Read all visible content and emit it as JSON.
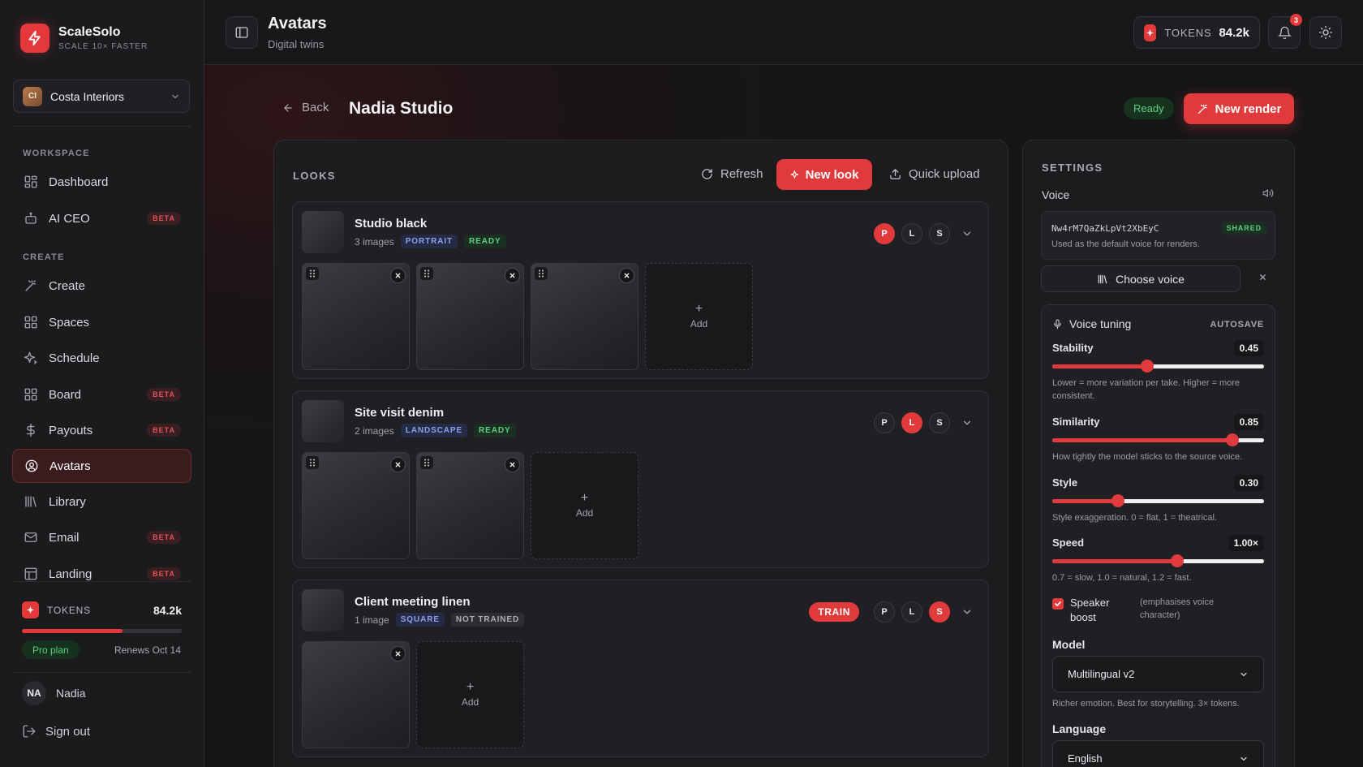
{
  "brand": {
    "name": "ScaleSolo",
    "tagline": "SCALE 10× FASTER"
  },
  "workspace": {
    "initials": "CI",
    "name": "Costa Interiors"
  },
  "sidebar": {
    "sections": [
      {
        "label": "WORKSPACE",
        "items": [
          {
            "label": "Dashboard",
            "icon": "dashboard-icon",
            "badge": ""
          },
          {
            "label": "AI CEO",
            "icon": "robot-icon",
            "badge": "BETA"
          }
        ]
      },
      {
        "label": "CREATE",
        "items": [
          {
            "label": "Create",
            "icon": "magic-wand-icon",
            "badge": ""
          },
          {
            "label": "Spaces",
            "icon": "grid-icon",
            "badge": ""
          },
          {
            "label": "Schedule",
            "icon": "sparkle-icon",
            "badge": ""
          },
          {
            "label": "Board",
            "icon": "board-icon",
            "badge": "BETA"
          },
          {
            "label": "Payouts",
            "icon": "dollar-icon",
            "badge": "BETA"
          },
          {
            "label": "Avatars",
            "icon": "user-circle-icon",
            "badge": "",
            "active": true
          },
          {
            "label": "Library",
            "icon": "library-icon",
            "badge": ""
          },
          {
            "label": "Email",
            "icon": "mail-icon",
            "badge": "BETA"
          },
          {
            "label": "Landing",
            "icon": "layout-icon",
            "badge": "BETA"
          }
        ]
      }
    ],
    "tokens": {
      "label": "TOKENS",
      "value": "84.2k",
      "usage_fraction": 0.63
    },
    "plan": "Pro plan",
    "renews": "Renews Oct 14",
    "user": {
      "initials": "NA",
      "name": "Nadia"
    },
    "sign_out": "Sign out"
  },
  "header": {
    "title": "Avatars",
    "subtitle": "Digital twins",
    "tokens_label": "TOKENS",
    "tokens_value": "84.2k",
    "notifications_count": "3"
  },
  "page": {
    "back_label": "Back",
    "title": "Nadia Studio",
    "status": "Ready",
    "new_render": "New render"
  },
  "looks": {
    "label": "LOOKS",
    "refresh": "Refresh",
    "new_look": "New look",
    "quick_upload": "Quick upload",
    "add_label": "Add",
    "items": [
      {
        "name": "Studio black",
        "count": "3 images",
        "tags": [
          "PORTRAIT",
          "READY"
        ],
        "formats": [
          "P",
          "L",
          "S"
        ],
        "active_format": "P",
        "train": "",
        "images": 3
      },
      {
        "name": "Site visit denim",
        "count": "2 images",
        "tags": [
          "LANDSCAPE",
          "READY"
        ],
        "formats": [
          "P",
          "L",
          "S"
        ],
        "active_format": "L",
        "train": "",
        "images": 2
      },
      {
        "name": "Client meeting linen",
        "count": "1 image",
        "tags": [
          "SQUARE",
          "NOT TRAINED"
        ],
        "formats": [
          "P",
          "L",
          "S"
        ],
        "active_format": "S",
        "train": "TRAIN",
        "images": 1
      }
    ]
  },
  "settings": {
    "label": "SETTINGS",
    "voice_label": "Voice",
    "voice_id": "Nw4rM7QaZkLpVt2XbEyC",
    "voice_badge": "SHARED",
    "voice_desc": "Used as the default voice for renders.",
    "choose_voice": "Choose voice",
    "tuning_title": "Voice tuning",
    "autosave": "AUTOSAVE",
    "sliders": [
      {
        "name": "Stability",
        "value": "0.45",
        "fraction": 0.45,
        "help": "Lower = more variation per take. Higher = more consistent."
      },
      {
        "name": "Similarity",
        "value": "0.85",
        "fraction": 0.85,
        "help": "How tightly the model sticks to the source voice."
      },
      {
        "name": "Style",
        "value": "0.30",
        "fraction": 0.31,
        "help": "Style exaggeration. 0 = flat, 1 = theatrical."
      },
      {
        "name": "Speed",
        "value": "1.00×",
        "fraction": 0.59,
        "help": "0.7 = slow, 1.0 = natural, 1.2 = fast."
      }
    ],
    "speaker_boost": {
      "label": "Speaker boost",
      "hint": "(emphasises voice character)",
      "checked": true
    },
    "model": {
      "label": "Model",
      "value": "Multilingual v2",
      "help": "Richer emotion. Best for storytelling. 3× tokens."
    },
    "language": {
      "label": "Language",
      "value": "English"
    }
  }
}
